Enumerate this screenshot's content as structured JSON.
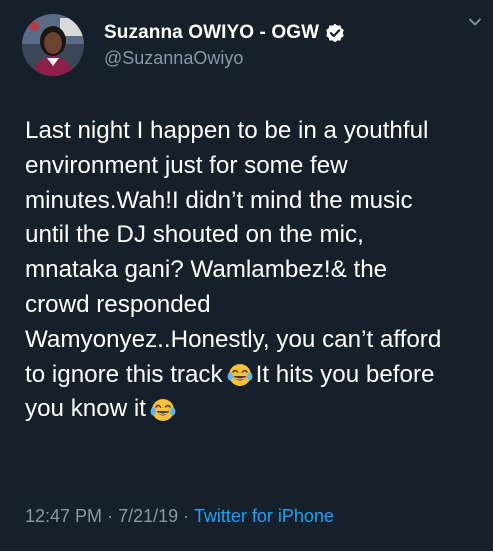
{
  "author": {
    "display_name": "Suzanna OWIYO - OGW",
    "handle": "@SuzannaOwiyo",
    "verified": true
  },
  "tweet": {
    "lines": [
      "Last night I happen to be in a youthful",
      "environment just for some few",
      "minutes.Wah!I didn’t mind the music",
      "until the DJ shouted on the mic,",
      "mnataka gani? Wamlambez!& the",
      "crowd responded",
      "Wamyonyez..Honestly, you can’t afford",
      "to ignore this track",
      "It hits you before",
      "you know it"
    ],
    "emoji": "face-with-tears-of-joy"
  },
  "meta": {
    "time": "12:47 PM",
    "separator": "·",
    "date": "7/21/19",
    "source": "Twitter for iPhone"
  },
  "colors": {
    "background": "#15202b",
    "text": "#ffffff",
    "secondary": "#8899a6",
    "link": "#1da1f2",
    "verified_badge": "#ffffff"
  }
}
